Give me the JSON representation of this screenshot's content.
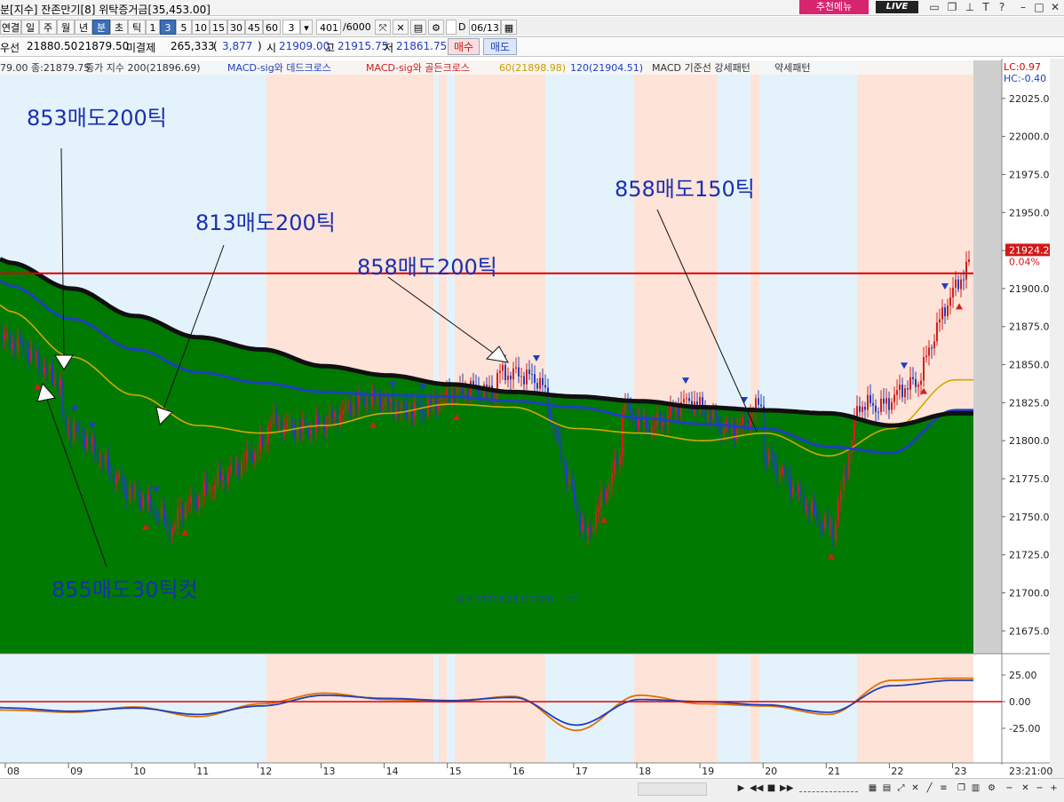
{
  "titlebar": {
    "title": "분[지수] 잔존만기[8] 위탁증거금[35,453.00]",
    "recommend_label": "추천메뉴",
    "live_label": "LIVE"
  },
  "toolbar": {
    "period_tabs": [
      "연결",
      "일",
      "주",
      "월",
      "년",
      "분",
      "초",
      "틱"
    ],
    "selected_period": "분",
    "interval_buttons": [
      "1",
      "3",
      "5",
      "10",
      "15",
      "30",
      "45",
      "60"
    ],
    "selected_interval": "3",
    "interval_value": "3",
    "count_value": "401",
    "count_total": "/6000",
    "date_checkbox_label": "D",
    "date_value": "06/13"
  },
  "quote": {
    "bid_label": "우선",
    "bid": "21880.50",
    "ask": "21879.50",
    "unsettled_label": "미결제",
    "unsettled": "265,333",
    "unsettled_change": "3,877",
    "open_label": "시",
    "open": "21909.00",
    "high_label": "고",
    "high": "21915.75",
    "low_label": "저",
    "low": "21861.75",
    "buy_label": "매수",
    "sell_label": "매도"
  },
  "legend": {
    "items": [
      {
        "text": "79.00 종:21879.75",
        "color": "#333333"
      },
      {
        "text": "종가 지수 200(21896.69)",
        "color": "#333333"
      },
      {
        "text": "MACD-sig와 데드크로스",
        "color": "#1f3fbf"
      },
      {
        "text": "MACD-sig와 골든크로스",
        "color": "#cc2020"
      },
      {
        "text": "60(21898.98)",
        "color": "#c89c00"
      },
      {
        "text": "120(21904.51)",
        "color": "#1f3fbf"
      },
      {
        "text": "MACD 기준선 강세패턴",
        "color": "#333333"
      },
      {
        "text": "약세패턴",
        "color": "#333333"
      }
    ],
    "lc_label": "LC:0.97",
    "hc_label": "HC:-0.40"
  },
  "price_axis": {
    "ticks": [
      "22025.00",
      "22000.00",
      "21975.00",
      "21950.00",
      "21925.00",
      "21900.00",
      "21875.00",
      "21850.00",
      "21825.00",
      "21800.00",
      "21775.00",
      "21750.00",
      "21725.00",
      "21700.00",
      "21675.00"
    ],
    "current_price": "21924.25",
    "current_change": "0.04%"
  },
  "macd_axis": {
    "ticks": [
      "25.00",
      "0.00",
      "-25.00"
    ]
  },
  "time_axis": {
    "labels": [
      "08",
      "09",
      "10",
      "11",
      "12",
      "13",
      "14",
      "15",
      "16",
      "17",
      "18",
      "19",
      "20",
      "21",
      "22",
      "23"
    ],
    "clock": "23:21:00"
  },
  "annotations": [
    {
      "text": "853매도200틱",
      "color": "#1a2fb0"
    },
    {
      "text": "813매도200틱",
      "color": "#1a2fb0"
    },
    {
      "text": "858매도200틱",
      "color": "#1a2fb0"
    },
    {
      "text": "858매도150틱",
      "color": "#1a2fb0"
    },
    {
      "text": "855매도30틱컷",
      "color": "#1a2fb0"
    }
  ],
  "low_marker": "최저 21713.25 (17:03)",
  "colors": {
    "cloud_fill": "#007a00",
    "bull_band": "#fde3d8",
    "bear_band": "#e4f3fb",
    "candle_up": "#d02020",
    "candle_down": "#1f3fbf",
    "ma200": "#101010",
    "ma120": "#1f3fbf",
    "ma60": "#d4a800",
    "resistance": "#e00000"
  },
  "chart_data": [
    {
      "type": "line",
      "title": "",
      "series": [
        {
          "name": "종가 지수 200",
          "values": [
            21917,
            21900,
            21882,
            21868,
            21860,
            21849,
            21843,
            21837,
            21832,
            21829,
            21826,
            21822,
            21820,
            21818,
            21810,
            21818
          ]
        },
        {
          "name": "120",
          "values": [
            21902,
            21880,
            21860,
            21845,
            21838,
            21832,
            21830,
            21829,
            21826,
            21822,
            21815,
            21811,
            21808,
            21796,
            21792,
            21820
          ]
        },
        {
          "name": "60",
          "values": [
            21885,
            21855,
            21830,
            21810,
            21805,
            21810,
            21818,
            21824,
            21822,
            21808,
            21805,
            21800,
            21805,
            21790,
            21808,
            21840
          ]
        }
      ],
      "x": [
        "08",
        "09",
        "10",
        "11",
        "12",
        "13",
        "14",
        "15",
        "16",
        "17",
        "18",
        "19",
        "20",
        "21",
        "22",
        "23"
      ],
      "resistance": 21910,
      "last": 21924.25,
      "low": 21713.25,
      "ylim": [
        21660,
        22050
      ]
    },
    {
      "type": "line",
      "series": [
        {
          "name": "MACD",
          "values": [
            -8,
            -10,
            -5,
            -14,
            -2,
            8,
            2,
            0,
            5,
            -27,
            6,
            -2,
            -4,
            -12,
            20,
            22
          ]
        },
        {
          "name": "Signal",
          "values": [
            -6,
            -9,
            -6,
            -12,
            -4,
            6,
            3,
            1,
            4,
            -22,
            2,
            0,
            -3,
            -10,
            15,
            20
          ]
        }
      ],
      "ylim": [
        -45,
        45
      ]
    }
  ]
}
